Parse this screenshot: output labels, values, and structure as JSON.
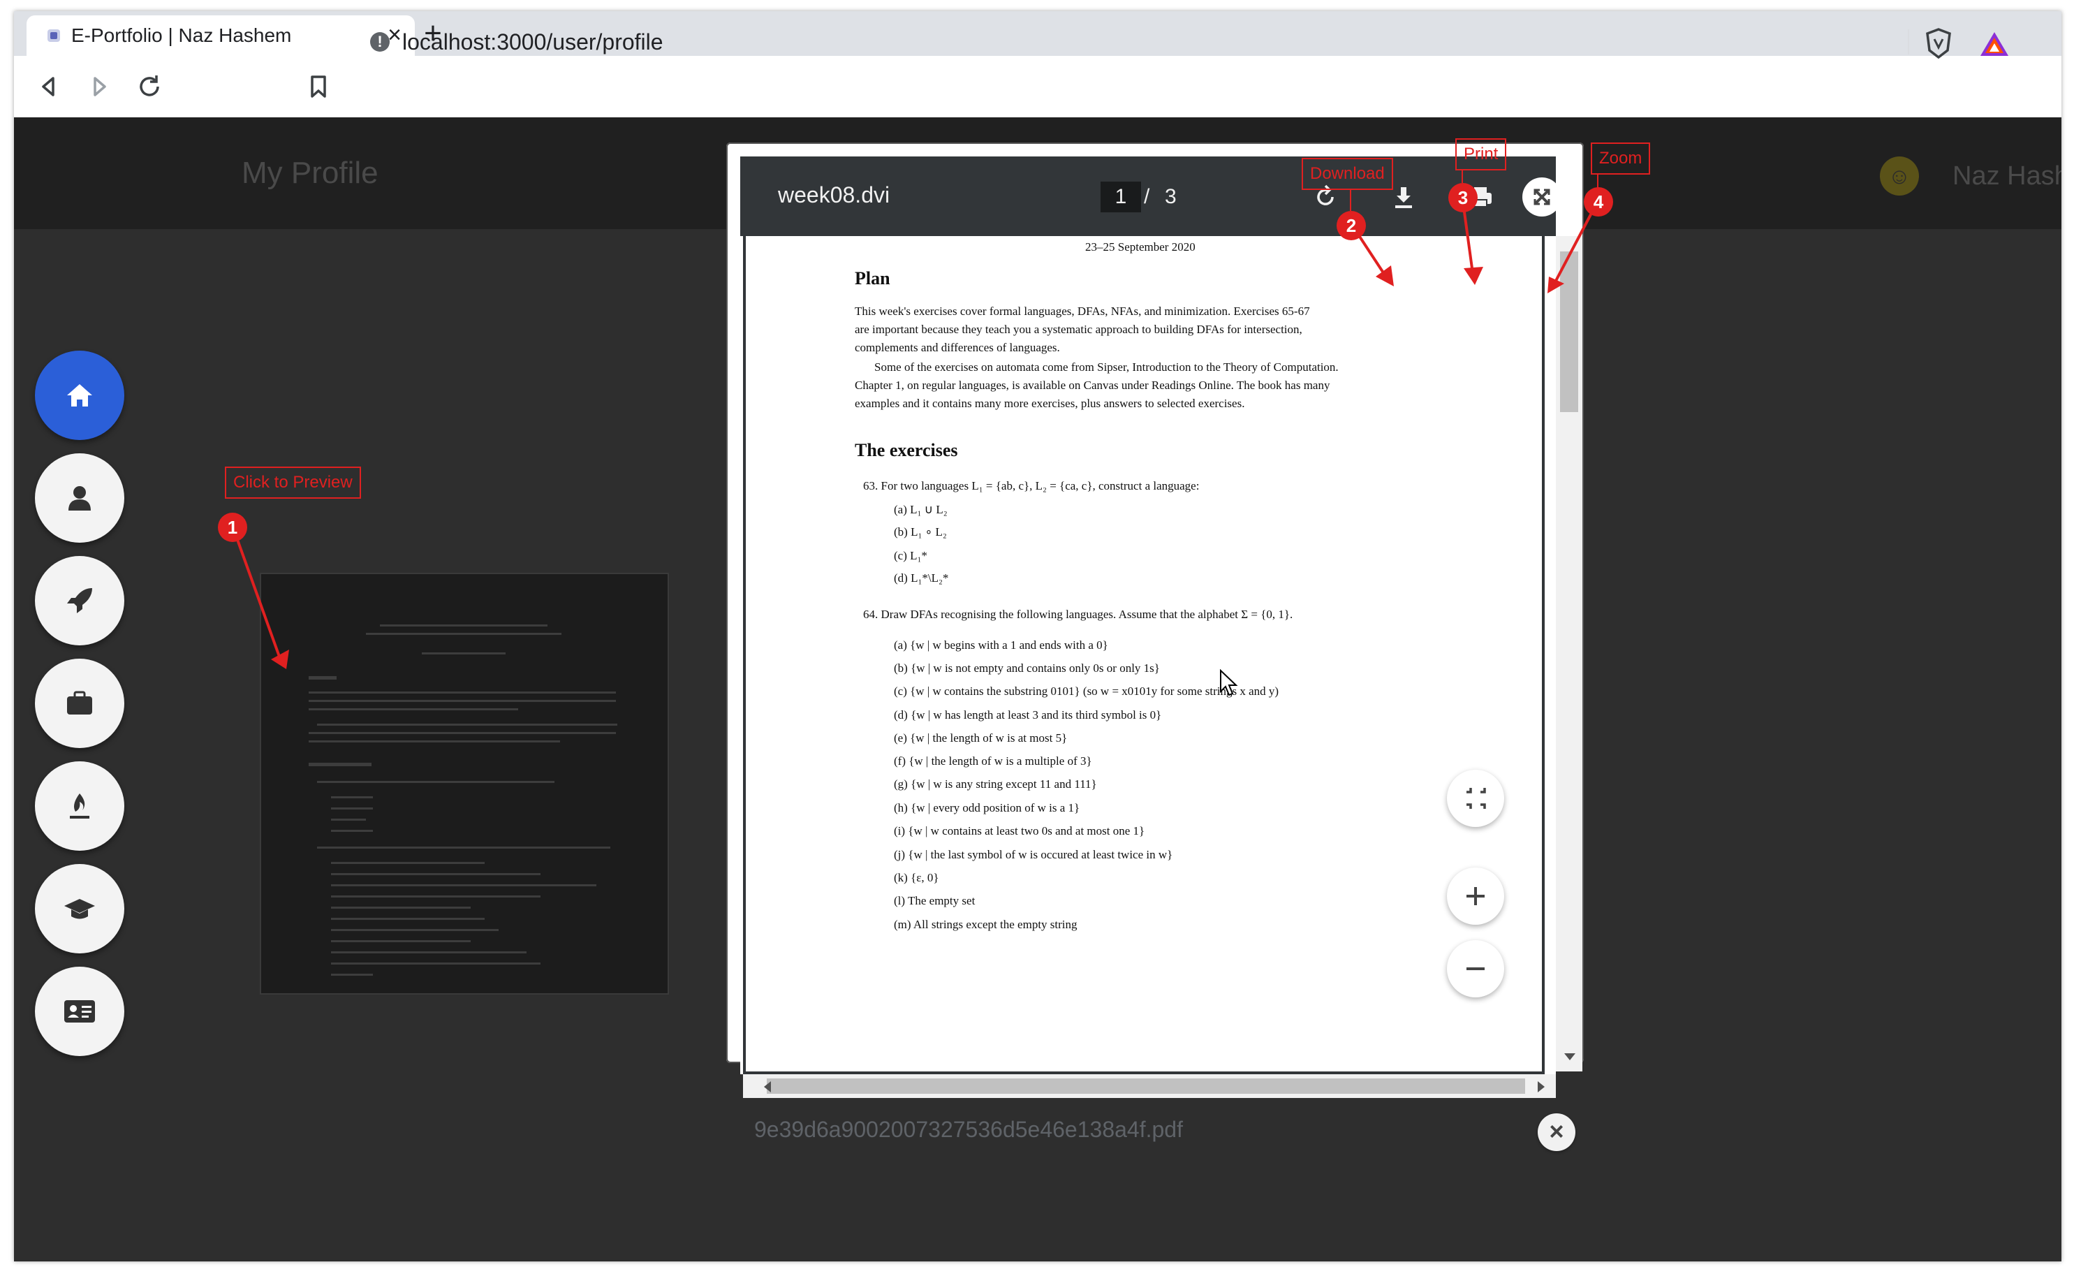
{
  "browser": {
    "tab_title": "E-Portfolio | Naz Hashem",
    "url": "localhost:3000/user/profile",
    "new_tab_symbol": "+",
    "close_tab_symbol": "×"
  },
  "app": {
    "title": "My Profile",
    "user_name": "Naz Hashem",
    "avatar_icon": "smiley-avatar-icon",
    "sidebar": [
      {
        "icon": "home-icon",
        "active": true
      },
      {
        "icon": "user-icon",
        "active": false
      },
      {
        "icon": "rocket-icon",
        "active": false
      },
      {
        "icon": "briefcase-icon",
        "active": false
      },
      {
        "icon": "flame-icon",
        "active": false
      },
      {
        "icon": "graduation-cap-icon",
        "active": false
      },
      {
        "icon": "id-card-icon",
        "active": false
      }
    ]
  },
  "viewer": {
    "doc_name": "week08.dvi",
    "page_current": "1",
    "page_separator": "/",
    "page_total": "3",
    "file_name": "9e39d6a9002007327536d5e46e138a4f.pdf",
    "document": {
      "date": "23–25 September 2020",
      "plan_heading": "Plan",
      "plan_lines": [
        "This week's exercises cover formal languages, DFAs, NFAs, and minimization.  Exercises 65-67",
        "are important because they teach you a systematic approach to building DFAs for intersection,",
        "complements and differences of languages.",
        "Some of the exercises on automata come from Sipser, Introduction to the Theory of Computation.",
        "Chapter 1, on regular languages, is available on Canvas under Readings Online.  The book has many",
        "examples and it contains many more exercises, plus answers to selected exercises."
      ],
      "exercises_heading": "The exercises",
      "ex63": "63.  For two languages L₁ = {ab, c}, L₂ = {ca, c}, construct a language:",
      "ex63_items": [
        "(a)  L₁ ∪ L₂",
        "(b)  L₁ ∘ L₂",
        "(c)  L₁*",
        "(d)  L₁*\\L₂*"
      ],
      "ex64": "64.  Draw DFAs recognising the following languages.  Assume that the alphabet Σ = {0, 1}.",
      "ex64_items": [
        "(a)  {w | w begins with a 1 and ends with a 0}",
        "(b)  {w | w is not empty and contains only 0s or only 1s}",
        "(c)  {w | w contains the substring 0101} (so w = x0101y for some strings x and y)",
        "(d)  {w | w has length at least 3 and its third symbol is 0}",
        "(e)  {w | the length of w is at most 5}",
        "(f)  {w | the length of w is a multiple of 3}",
        "(g)  {w | w is any string except 11 and 111}",
        "(h)  {w | every odd position of w is a 1}",
        "(i)  {w | w contains at least two 0s and at most one 1}",
        "(j)  {w | the last symbol of w is occured at least twice in w}",
        "(k)  {ε, 0}",
        "(l)  The empty set",
        "(m)  All strings except the empty string"
      ]
    }
  },
  "annotations": {
    "click_preview": {
      "label": "Click to Preview",
      "num": "1"
    },
    "download": {
      "label": "Download",
      "num": "2"
    },
    "print": {
      "label": "Print",
      "num": "3"
    },
    "zoom": {
      "label": "Zoom",
      "num": "4"
    },
    "color": "#e02020"
  },
  "colors": {
    "page_bg": "#2e2e2e",
    "app_bar": "#202020",
    "active_nav": "#2b5fd8",
    "viewer_bar": "#323639"
  }
}
